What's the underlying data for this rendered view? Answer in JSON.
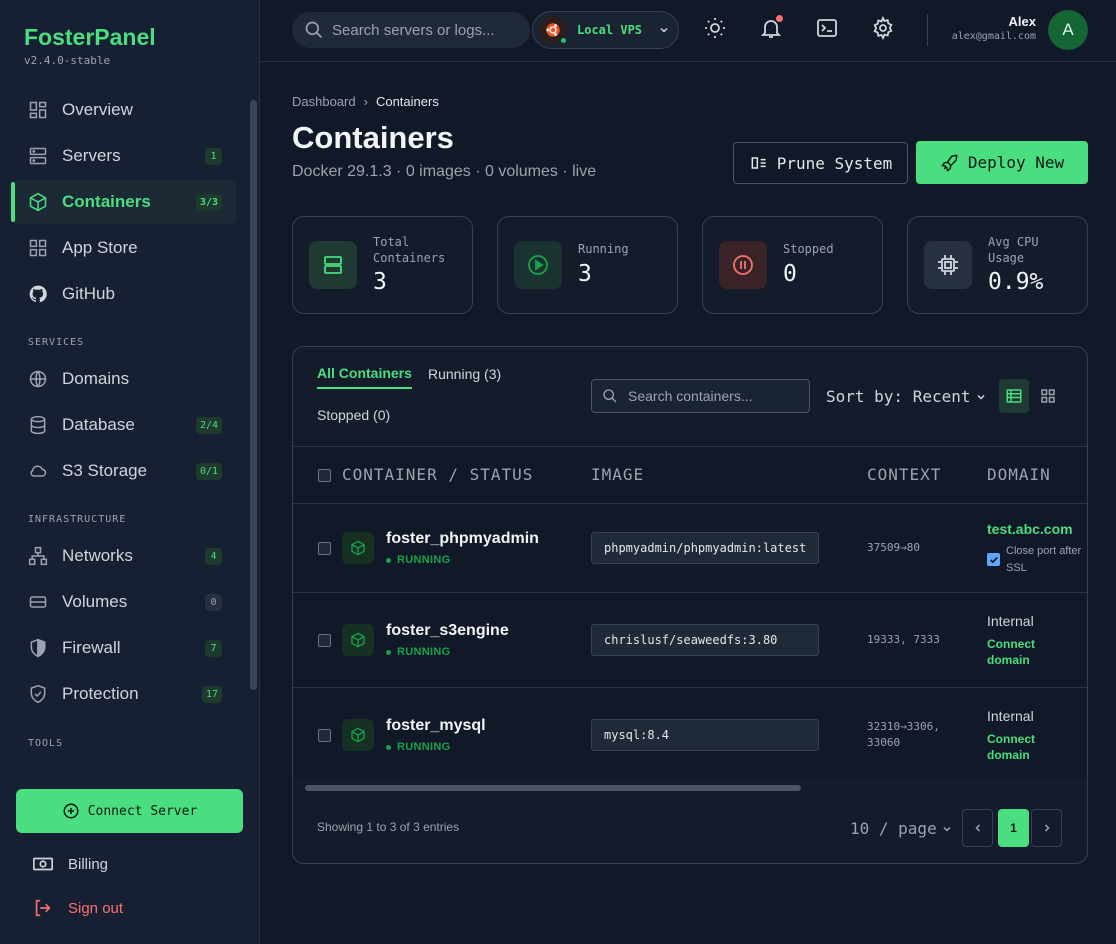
{
  "brand": {
    "name": "FosterPanel",
    "version": "v2.4.0-stable"
  },
  "sidebar": {
    "items": [
      {
        "label": "Overview",
        "icon": "dashboard-icon",
        "badge": ""
      },
      {
        "label": "Servers",
        "icon": "server-icon",
        "badge": "1"
      },
      {
        "label": "Containers",
        "icon": "cube-icon",
        "badge": "3/3",
        "active": true
      },
      {
        "label": "App Store",
        "icon": "grid-icon",
        "badge": ""
      },
      {
        "label": "GitHub",
        "icon": "github-icon",
        "badge": ""
      }
    ],
    "services_title": "SERVICES",
    "services": [
      {
        "label": "Domains",
        "icon": "globe-icon",
        "badge": ""
      },
      {
        "label": "Database",
        "icon": "database-icon",
        "badge": "2/4"
      },
      {
        "label": "S3 Storage",
        "icon": "cloud-icon",
        "badge": "0/1"
      }
    ],
    "infra_title": "INFRASTRUCTURE",
    "infra": [
      {
        "label": "Networks",
        "icon": "network-icon",
        "badge": "4"
      },
      {
        "label": "Volumes",
        "icon": "drive-icon",
        "badge": "0"
      },
      {
        "label": "Firewall",
        "icon": "shield-icon",
        "badge": "7"
      },
      {
        "label": "Protection",
        "icon": "shield-check-icon",
        "badge": "17"
      }
    ],
    "tools_title": "TOOLS",
    "connect_label": "Connect Server",
    "billing_label": "Billing",
    "signout_label": "Sign out"
  },
  "topbar": {
    "search_placeholder": "Search servers or logs...",
    "server_name": "Local VPS",
    "user_name": "Alex",
    "user_email": "alex@gmail.com",
    "avatar_letter": "A"
  },
  "page": {
    "breadcrumb": [
      "Dashboard",
      "Containers"
    ],
    "title": "Containers",
    "subtitle": "Docker 29.1.3 · 0 images · 0 volumes · live",
    "prune_label": "Prune System",
    "deploy_label": "Deploy New"
  },
  "stats": [
    {
      "label": "Total Containers",
      "value": "3",
      "color": "#4ade80"
    },
    {
      "label": "Running",
      "value": "3",
      "color": "#22c55e"
    },
    {
      "label": "Stopped",
      "value": "0",
      "color": "#f87171"
    },
    {
      "label": "Avg CPU Usage",
      "value": "0.9%",
      "color": "#d1d5db"
    }
  ],
  "table": {
    "tabs": [
      "All Containers",
      "Running (3)",
      "Stopped (0)"
    ],
    "search_placeholder": "Search containers...",
    "sort_label": "Sort by: Recent",
    "columns": [
      "CONTAINER / STATUS",
      "IMAGE",
      "CONTEXT",
      "DOMAIN"
    ],
    "rows": [
      {
        "name": "foster_phpmyadmin",
        "status": "RUNNING",
        "image": "phpmyadmin/phpmyadmin:latest",
        "context": "37509→80",
        "domain": "test.abc.com",
        "close_port": "Close port after SSL"
      },
      {
        "name": "foster_s3engine",
        "status": "RUNNING",
        "image": "chrislusf/seaweedfs:3.80",
        "context": "19333, 7333",
        "domain_internal": "Internal",
        "connect": "Connect domain"
      },
      {
        "name": "foster_mysql",
        "status": "RUNNING",
        "image": "mysql:8.4",
        "context": "32310→3306, 33060",
        "domain_internal": "Internal",
        "connect": "Connect domain"
      }
    ],
    "showing": "Showing 1 to 3 of 3 entries",
    "per_page": "10 / page",
    "current_page": "1"
  }
}
